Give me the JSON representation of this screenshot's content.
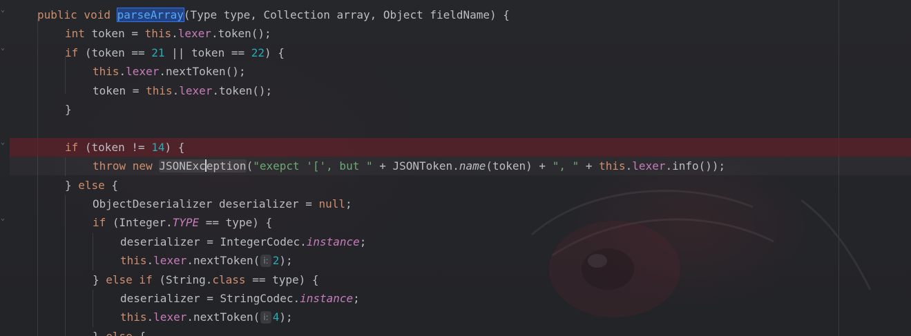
{
  "editor": {
    "lines": [
      {
        "indent": 1,
        "tokens": [
          {
            "t": "public void ",
            "c": "kw"
          },
          {
            "t": "parseArray",
            "c": "hl-usage"
          },
          {
            "t": "(Type type, Collection array, Object fieldName) {",
            "c": ""
          }
        ]
      },
      {
        "indent": 2,
        "tokens": [
          {
            "t": "int ",
            "c": "kw"
          },
          {
            "t": "token = ",
            "c": ""
          },
          {
            "t": "this",
            "c": "kw"
          },
          {
            "t": ".",
            "c": ""
          },
          {
            "t": "lexer",
            "c": "field"
          },
          {
            "t": ".token();",
            "c": ""
          }
        ]
      },
      {
        "indent": 2,
        "tokens": [
          {
            "t": "if ",
            "c": "kw"
          },
          {
            "t": "(token == ",
            "c": ""
          },
          {
            "t": "21",
            "c": "num"
          },
          {
            "t": " || token == ",
            "c": ""
          },
          {
            "t": "22",
            "c": "num"
          },
          {
            "t": ") {",
            "c": ""
          }
        ]
      },
      {
        "indent": 3,
        "tokens": [
          {
            "t": "this",
            "c": "kw"
          },
          {
            "t": ".",
            "c": ""
          },
          {
            "t": "lexer",
            "c": "field"
          },
          {
            "t": ".nextToken();",
            "c": ""
          }
        ]
      },
      {
        "indent": 3,
        "tokens": [
          {
            "t": "token = ",
            "c": ""
          },
          {
            "t": "this",
            "c": "kw"
          },
          {
            "t": ".",
            "c": ""
          },
          {
            "t": "lexer",
            "c": "field"
          },
          {
            "t": ".token();",
            "c": ""
          }
        ]
      },
      {
        "indent": 2,
        "tokens": [
          {
            "t": "}",
            "c": ""
          }
        ]
      },
      {
        "indent": 0,
        "tokens": []
      },
      {
        "indent": 2,
        "state": "error",
        "tokens": [
          {
            "t": "if ",
            "c": "kw"
          },
          {
            "t": "(token != ",
            "c": ""
          },
          {
            "t": "14",
            "c": "num"
          },
          {
            "t": ") {",
            "c": ""
          }
        ]
      },
      {
        "indent": 3,
        "state": "caret",
        "tokens": [
          {
            "t": "throw new ",
            "c": "kw"
          },
          {
            "t": "JSONExc",
            "c": "cls-hint"
          },
          {
            "t": "",
            "c": "caret"
          },
          {
            "t": "eption",
            "c": "cls-hint"
          },
          {
            "t": "(",
            "c": ""
          },
          {
            "t": "\"exepct '[', but \"",
            "c": "str"
          },
          {
            "t": " + JSONToken.",
            "c": ""
          },
          {
            "t": "name",
            "c": "italic"
          },
          {
            "t": "(token) + ",
            "c": ""
          },
          {
            "t": "\", \"",
            "c": "str"
          },
          {
            "t": " + ",
            "c": ""
          },
          {
            "t": "this",
            "c": "kw"
          },
          {
            "t": ".",
            "c": ""
          },
          {
            "t": "lexer",
            "c": "field"
          },
          {
            "t": ".info());",
            "c": ""
          }
        ]
      },
      {
        "indent": 2,
        "tokens": [
          {
            "t": "} ",
            "c": ""
          },
          {
            "t": "else",
            "c": "kw"
          },
          {
            "t": " {",
            "c": ""
          }
        ]
      },
      {
        "indent": 3,
        "tokens": [
          {
            "t": "ObjectDeserializer deserializer = ",
            "c": ""
          },
          {
            "t": "null",
            "c": "kw"
          },
          {
            "t": ";",
            "c": ""
          }
        ]
      },
      {
        "indent": 3,
        "tokens": [
          {
            "t": "if ",
            "c": "kw"
          },
          {
            "t": "(Integer.",
            "c": ""
          },
          {
            "t": "TYPE",
            "c": "static"
          },
          {
            "t": " == type) {",
            "c": ""
          }
        ]
      },
      {
        "indent": 4,
        "tokens": [
          {
            "t": "deserializer = IntegerCodec.",
            "c": ""
          },
          {
            "t": "instance",
            "c": "static"
          },
          {
            "t": ";",
            "c": ""
          }
        ]
      },
      {
        "indent": 4,
        "tokens": [
          {
            "t": "this",
            "c": "kw"
          },
          {
            "t": ".",
            "c": ""
          },
          {
            "t": "lexer",
            "c": "field"
          },
          {
            "t": ".nextToken(",
            "c": ""
          },
          {
            "t": "i:",
            "c": "param-hint"
          },
          {
            "t": "2",
            "c": "num"
          },
          {
            "t": ");",
            "c": ""
          }
        ]
      },
      {
        "indent": 3,
        "tokens": [
          {
            "t": "} ",
            "c": ""
          },
          {
            "t": "else if ",
            "c": "kw"
          },
          {
            "t": "(String.",
            "c": ""
          },
          {
            "t": "class",
            "c": "kw"
          },
          {
            "t": " == type) {",
            "c": ""
          }
        ]
      },
      {
        "indent": 4,
        "tokens": [
          {
            "t": "deserializer = StringCodec.",
            "c": ""
          },
          {
            "t": "instance",
            "c": "static"
          },
          {
            "t": ";",
            "c": ""
          }
        ]
      },
      {
        "indent": 4,
        "tokens": [
          {
            "t": "this",
            "c": "kw"
          },
          {
            "t": ".",
            "c": ""
          },
          {
            "t": "lexer",
            "c": "field"
          },
          {
            "t": ".nextToken(",
            "c": ""
          },
          {
            "t": "i:",
            "c": "param-hint"
          },
          {
            "t": "4",
            "c": "num"
          },
          {
            "t": ");",
            "c": ""
          }
        ]
      },
      {
        "indent": 3,
        "tokens": [
          {
            "t": "} ",
            "c": ""
          },
          {
            "t": "else",
            "c": "kw"
          },
          {
            "t": " {",
            "c": ""
          }
        ]
      }
    ],
    "colors": {
      "background": "#232428",
      "text": "#bcbec4",
      "keyword": "#cf8e6d",
      "number": "#2aacb8",
      "string": "#6aab73",
      "field": "#c77dbb",
      "method_usage_highlight": "#214283",
      "error_line": "#692028"
    }
  }
}
